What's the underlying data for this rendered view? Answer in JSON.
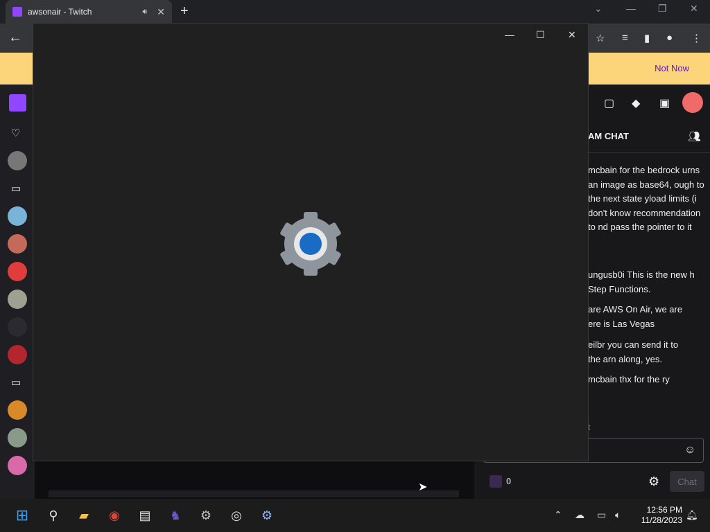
{
  "browser": {
    "tab_title": "awsonair - Twitch",
    "tab_audio_icon": "speaker-icon",
    "infobar_action": "Not Now"
  },
  "chat": {
    "header": "AM CHAT",
    "messages": [
      "mcbain for the bedrock urns an image as base64, ough to the next state yload limits (i don't know recommendation to nd pass the pointer to it",
      "ungusb0i This is the new h Step Functions.",
      "are AWS On Air, we are ere is Las Vegas",
      "eilbr you can send it to the arn along, yes.",
      "mcbain thx for the ry"
    ],
    "input_placeholder": "t",
    "points": "0",
    "send_label": "Chat"
  },
  "splash": {
    "app": "Settings",
    "icon": "gear-icon",
    "accent": "#1a6bc4"
  },
  "taskbar": {
    "time": "12:56 PM",
    "date": "11/28/2023"
  },
  "colors": {
    "twitch_purple": "#9146ff",
    "infobar": "#fcd479",
    "splash_bg": "#202020"
  }
}
